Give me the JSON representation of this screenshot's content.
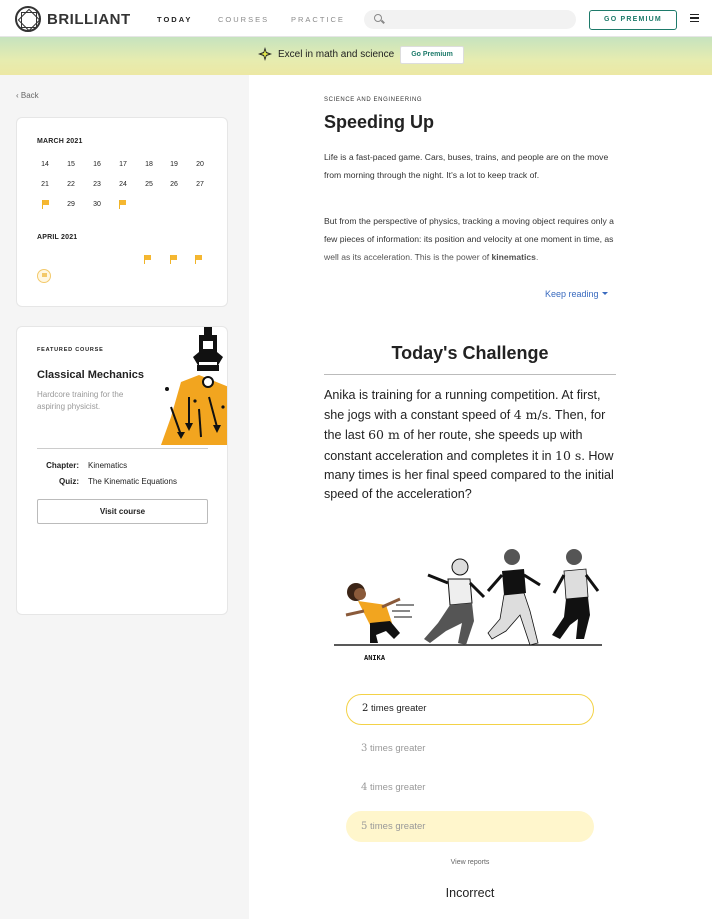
{
  "header": {
    "logo_text": "BRILLIANT",
    "nav": [
      "TODAY",
      "COURSES",
      "PRACTICE"
    ],
    "search_placeholder": "",
    "premium_button": "GO PREMIUM"
  },
  "banner": {
    "text": "Excel in math and science",
    "button": "Go Premium"
  },
  "sidebar": {
    "back": "Back",
    "calendar": {
      "march_label": "MARCH 2021",
      "march_rows": [
        [
          "14",
          "15",
          "16",
          "17",
          "18",
          "19",
          "20"
        ],
        [
          "21",
          "22",
          "23",
          "24",
          "25",
          "26",
          "27"
        ],
        [
          "",
          "29",
          "30",
          "",
          "",
          "",
          ""
        ]
      ],
      "april_label": "APRIL 2021"
    },
    "featured": {
      "eyebrow": "FEATURED COURSE",
      "title": "Classical Mechanics",
      "description": "Hardcore training for the aspiring physicist.",
      "chapter_label": "Chapter:",
      "chapter_value": "Kinematics",
      "quiz_label": "Quiz:",
      "quiz_value": "The Kinematic Equations",
      "visit_button": "Visit course"
    }
  },
  "article": {
    "eyebrow": "SCIENCE AND ENGINEERING",
    "title": "Speeding Up",
    "para1": "Life is a fast-paced game. Cars, buses, trains, and people are on the move from morning through the night. It's a lot to keep track of.",
    "para2_lead": "But from the perspective of physics, tracking a moving object requires only a few pieces of information: its position and velocity at one moment in time, as well as its acceleration. This is the power of ",
    "para2_bold": "kinematics",
    "para2_tail": ".",
    "keep_reading": "Keep reading"
  },
  "challenge": {
    "title": "Today's Challenge",
    "q1": "Anika is training for a running competition. At first, she jogs with a constant speed of ",
    "m1": "4 m/s",
    "q2": ". Then, for the last ",
    "m2": "60 m",
    "q3": " of her route, she speeds up with constant acceleration and completes it in ",
    "m3": "10 s",
    "q4": ". How many times is her final speed compared to the initial speed of the acceleration?",
    "illustration_label": "ANIKA",
    "options": [
      {
        "num": "2",
        "text": " times greater",
        "state": "selected"
      },
      {
        "num": "3",
        "text": " times greater",
        "state": "faded"
      },
      {
        "num": "4",
        "text": " times greater",
        "state": "faded"
      },
      {
        "num": "5",
        "text": " times greater",
        "state": "correct"
      }
    ],
    "view_reports": "View reports",
    "result": "Incorrect"
  },
  "colors": {
    "accent_green": "#1d7a6a",
    "flag_yellow": "#f5b731",
    "selected_border": "#f3d247",
    "correct_fill": "#fff6cc",
    "link_blue": "#3a6bbf"
  }
}
